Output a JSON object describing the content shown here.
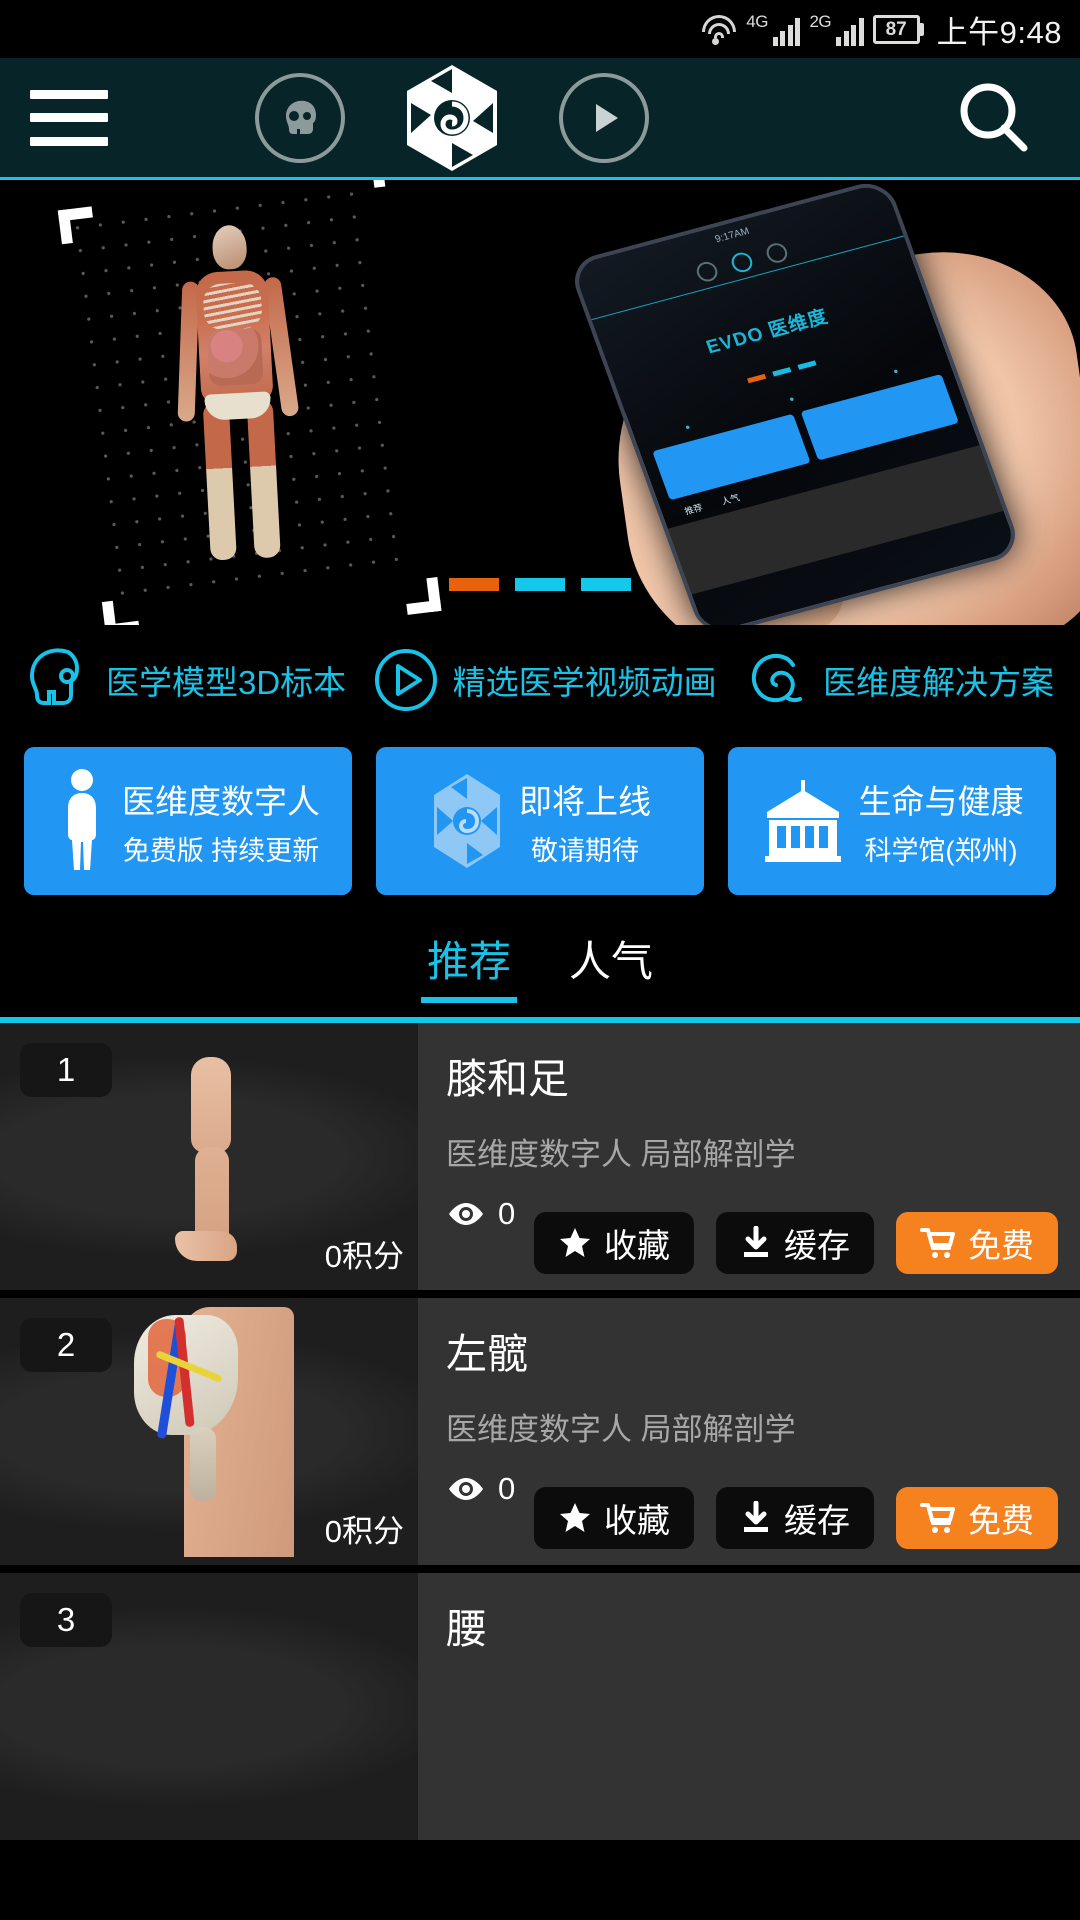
{
  "status_bar": {
    "wifi_icon": "wifi-icon",
    "network_1": "4G",
    "network_2": "2G",
    "battery_level": "87",
    "time": "上午9:48"
  },
  "header": {
    "menu_icon": "hamburger-menu-icon",
    "skull_icon": "skull-icon",
    "logo_icon": "evdo-hexagon-logo",
    "play_icon": "play-icon",
    "search_icon": "search-icon"
  },
  "banner": {
    "device_logo": "EVDO 医维度",
    "device_time": "9:17AM",
    "dots": [
      "active",
      "inactive",
      "inactive"
    ]
  },
  "features": [
    {
      "icon": "skull-icon",
      "label": "医学模型3D标本"
    },
    {
      "icon": "play-circle-icon",
      "label": "精选医学视频动画"
    },
    {
      "icon": "swirl-icon",
      "label": "医维度解决方案"
    }
  ],
  "promos": [
    {
      "icon": "human-body-icon",
      "line1": "医维度数字人",
      "line2": "免费版 持续更新"
    },
    {
      "icon": "hexagon-logo-icon",
      "line1": "即将上线",
      "line2": "敬请期待"
    },
    {
      "icon": "museum-building-icon",
      "line1": "生命与健康",
      "line2": "科学馆(郑州)"
    }
  ],
  "tabs": [
    {
      "label": "推荐",
      "active": true
    },
    {
      "label": "人气",
      "active": false
    }
  ],
  "list": [
    {
      "rank": "1",
      "title": "膝和足",
      "subtitle": "医维度数字人 局部解剖学",
      "points": "0积分",
      "views": "0",
      "view_icon": "eye-icon",
      "buttons": [
        {
          "icon": "star-icon",
          "label": "收藏"
        },
        {
          "icon": "download-icon",
          "label": "缓存"
        },
        {
          "icon": "cart-icon",
          "label": "免费"
        }
      ]
    },
    {
      "rank": "2",
      "title": "左髋",
      "subtitle": "医维度数字人 局部解剖学",
      "points": "0积分",
      "views": "0",
      "view_icon": "eye-icon",
      "buttons": [
        {
          "icon": "star-icon",
          "label": "收藏"
        },
        {
          "icon": "download-icon",
          "label": "缓存"
        },
        {
          "icon": "cart-icon",
          "label": "免费"
        }
      ]
    },
    {
      "rank": "3",
      "title": "腰",
      "subtitle": "",
      "points": "",
      "views": "",
      "view_icon": "eye-icon",
      "buttons": []
    }
  ],
  "colors": {
    "accent_cyan": "#19c2e6",
    "promo_blue": "#2196f3",
    "buy_orange": "#f5821f",
    "header_teal": "#072529",
    "row_bg": "#333333"
  }
}
